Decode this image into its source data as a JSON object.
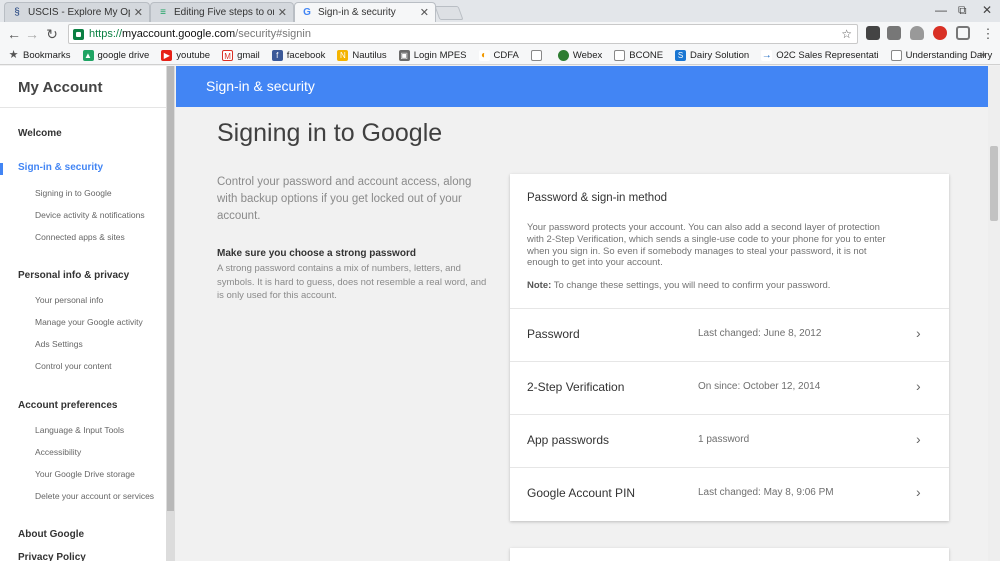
{
  "browser": {
    "tabs": [
      {
        "title": "USCIS - Explore My Options",
        "icon": "uscis-icon"
      },
      {
        "title": "Editing Five steps to online",
        "icon": "edit-icon"
      },
      {
        "title": "Sign-in & security",
        "icon": "google-icon"
      }
    ],
    "url": {
      "scheme": "https://",
      "host": "myaccount.google.com",
      "path": "/security#signin"
    },
    "bookmarks": [
      "Bookmarks",
      "google drive",
      "youtube",
      "gmail",
      "facebook",
      "Nautilus",
      "Login MPES",
      "CDFA",
      "",
      "Webex",
      "BCONE",
      "Dairy Solution",
      "O2C Sales Representati",
      "Understanding Dairy"
    ],
    "bookmark_more": "»",
    "brand_color": "#4285f4"
  },
  "sidebar": {
    "title": "My Account",
    "welcome": "Welcome",
    "sections": [
      {
        "label": "Sign-in & security",
        "items": [
          "Signing in to Google",
          "Device activity & notifications",
          "Connected apps & sites"
        ]
      },
      {
        "label": "Personal info & privacy",
        "items": [
          "Your personal info",
          "Manage your Google activity",
          "Ads Settings",
          "Control your content"
        ]
      },
      {
        "label": "Account preferences",
        "items": [
          "Language & Input Tools",
          "Accessibility",
          "Your Google Drive storage",
          "Delete your account or services"
        ]
      }
    ],
    "about": "About Google",
    "privacy": "Privacy Policy"
  },
  "header": {
    "title": "Sign-in & security"
  },
  "main": {
    "title": "Signing in to Google",
    "intro": "Control your password and account access, along with backup options if you get locked out of your account.",
    "tip_title": "Make sure you choose a strong password",
    "tip_body": "A strong password contains a mix of numbers, letters, and symbols. It is hard to guess, does not resemble a real word, and is only used for this account."
  },
  "card": {
    "title": "Password & sign-in method",
    "description": "Your password protects your account. You can also add a second layer of protection with 2-Step Verification, which sends a single-use code to your phone for you to enter when you sign in. So even if somebody manages to steal your password, it is not enough to get into your account.",
    "note_label": "Note:",
    "note_text": " To change these settings, you will need to confirm your password.",
    "rows": [
      {
        "label": "Password",
        "value": "Last changed: June 8, 2012"
      },
      {
        "label": "2-Step Verification",
        "value": "On since: October 12, 2014"
      },
      {
        "label": "App passwords",
        "value": "1 password"
      },
      {
        "label": "Google Account PIN",
        "value": "Last changed: May 8, 9:06 PM"
      }
    ]
  }
}
